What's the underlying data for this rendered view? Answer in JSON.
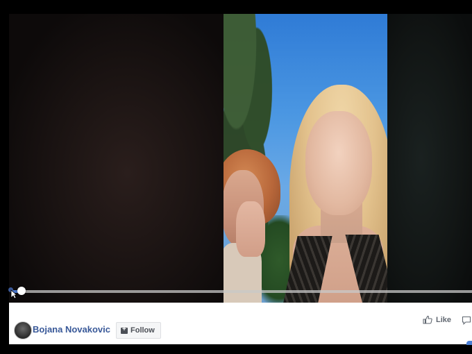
{
  "video": {
    "progress_fraction": 0.02
  },
  "post": {
    "author_name": "Bojana Novakovic",
    "follow_label": "Follow",
    "like_label": "Like"
  },
  "colors": {
    "link_blue": "#385898",
    "progress_blue": "#4a76c9"
  },
  "icons": {
    "follow": "follow-plus-icon",
    "like": "thumbs-up-icon",
    "comment": "comment-icon"
  }
}
